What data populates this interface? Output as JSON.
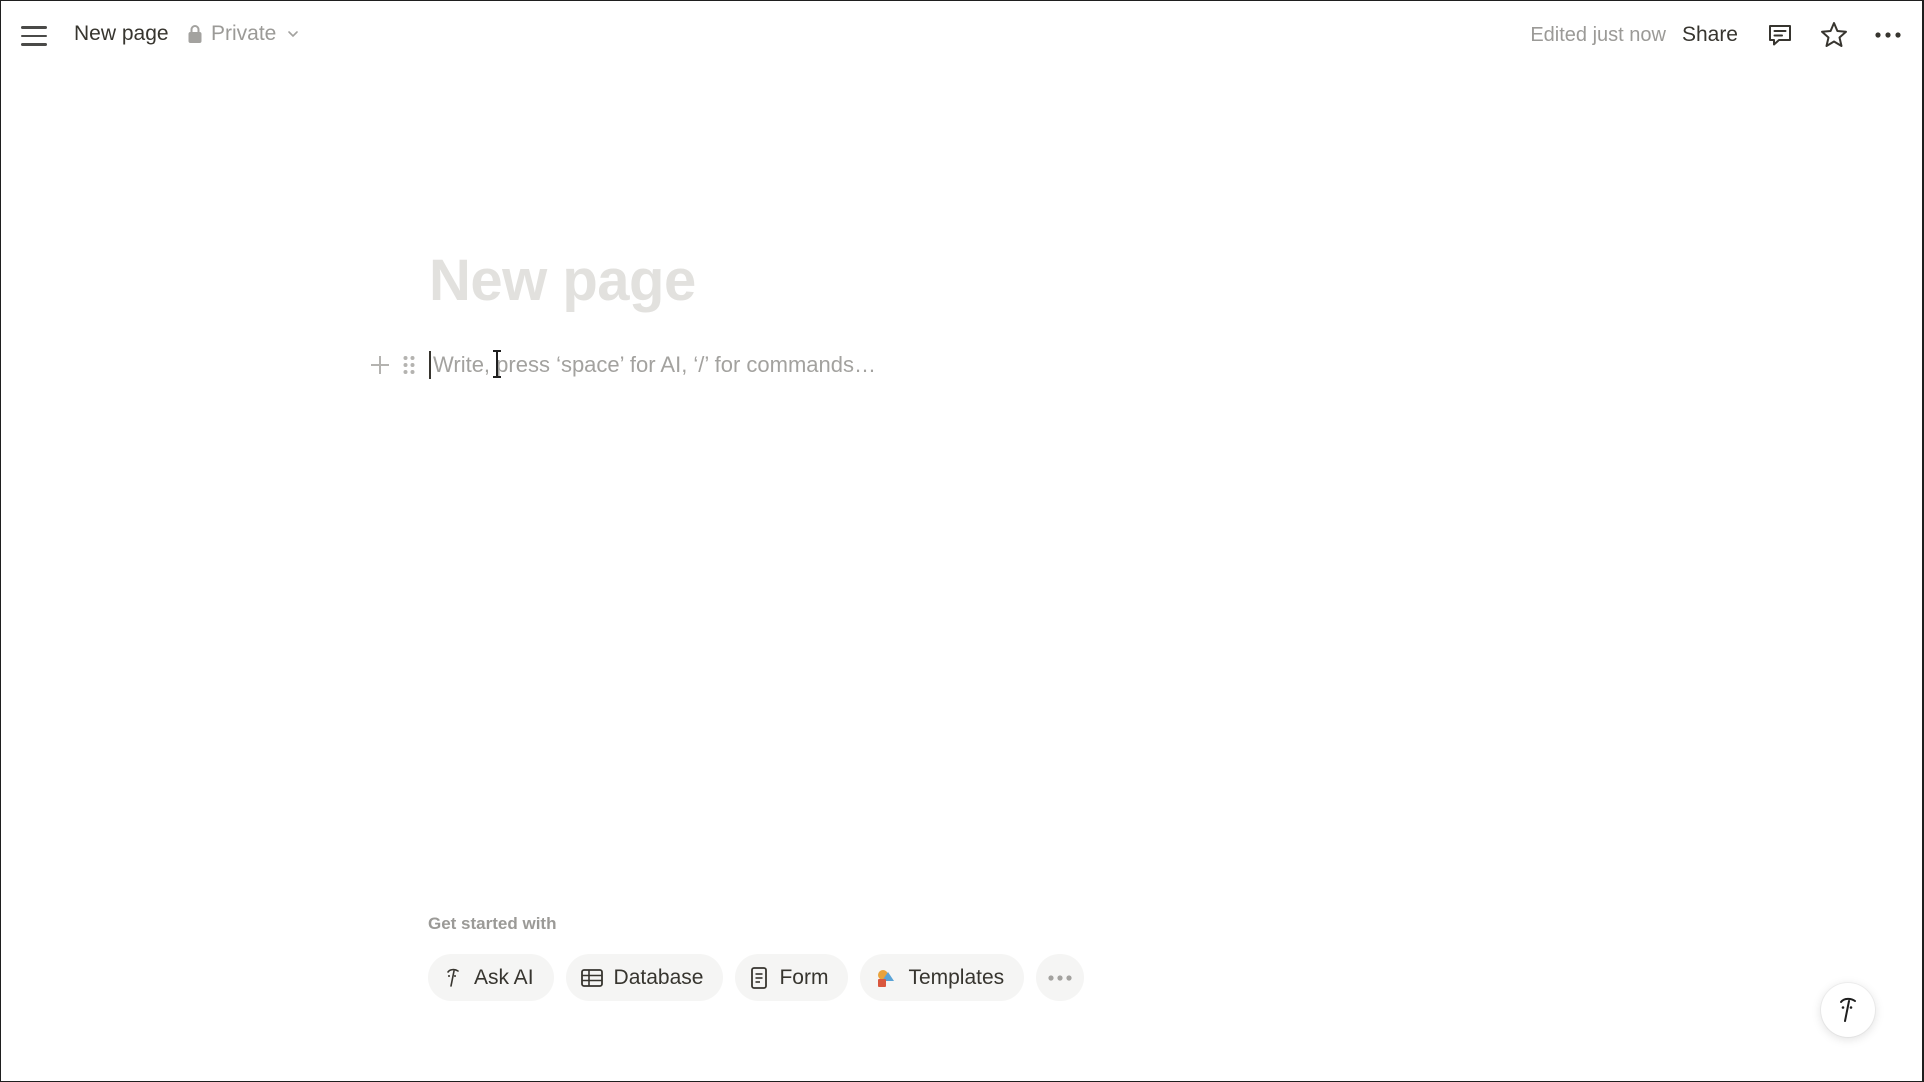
{
  "topbar": {
    "page_name": "New page",
    "privacy_label": "Private",
    "edited_status": "Edited just now",
    "share_label": "Share",
    "icons": [
      "menu-icon",
      "lock-icon",
      "chevron-down-icon",
      "comment-icon",
      "star-icon",
      "more-horizontal-icon"
    ]
  },
  "page": {
    "title_placeholder": "New page",
    "editor_placeholder": "Write, press ‘space’ for AI, ‘/’ for commands…",
    "editor_value": ""
  },
  "get_started": {
    "heading": "Get started with",
    "chips": [
      {
        "label": "Ask AI",
        "icon": "ai-face-icon"
      },
      {
        "label": "Database",
        "icon": "table-icon"
      },
      {
        "label": "Form",
        "icon": "form-icon"
      },
      {
        "label": "Templates",
        "icon": "shapes-icon"
      }
    ],
    "more_icon": "more-horizontal-icon"
  },
  "colors": {
    "text": "#37352f",
    "muted": "#9b9a97",
    "title_placeholder": "#e2e1de",
    "chip_bg": "#f5f5f4"
  }
}
